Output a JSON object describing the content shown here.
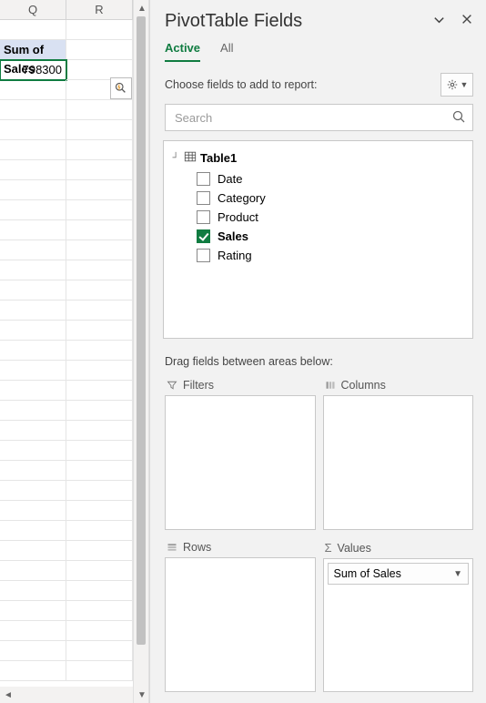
{
  "spreadsheet": {
    "columns": [
      "Q",
      "R"
    ],
    "pivot_header": "Sum of Sales",
    "pivot_value": "798300"
  },
  "pane": {
    "title": "PivotTable Fields",
    "tabs": {
      "active": "Active",
      "all": "All"
    },
    "choose_label": "Choose fields to add to report:",
    "search_placeholder": "Search",
    "table_name": "Table1",
    "fields": [
      {
        "label": "Date",
        "checked": false
      },
      {
        "label": "Category",
        "checked": false
      },
      {
        "label": "Product",
        "checked": false
      },
      {
        "label": "Sales",
        "checked": true
      },
      {
        "label": "Rating",
        "checked": false
      }
    ],
    "drag_label": "Drag fields between areas below:",
    "areas": {
      "filters": "Filters",
      "columns": "Columns",
      "rows": "Rows",
      "values": "Values"
    },
    "value_item": "Sum of Sales"
  }
}
